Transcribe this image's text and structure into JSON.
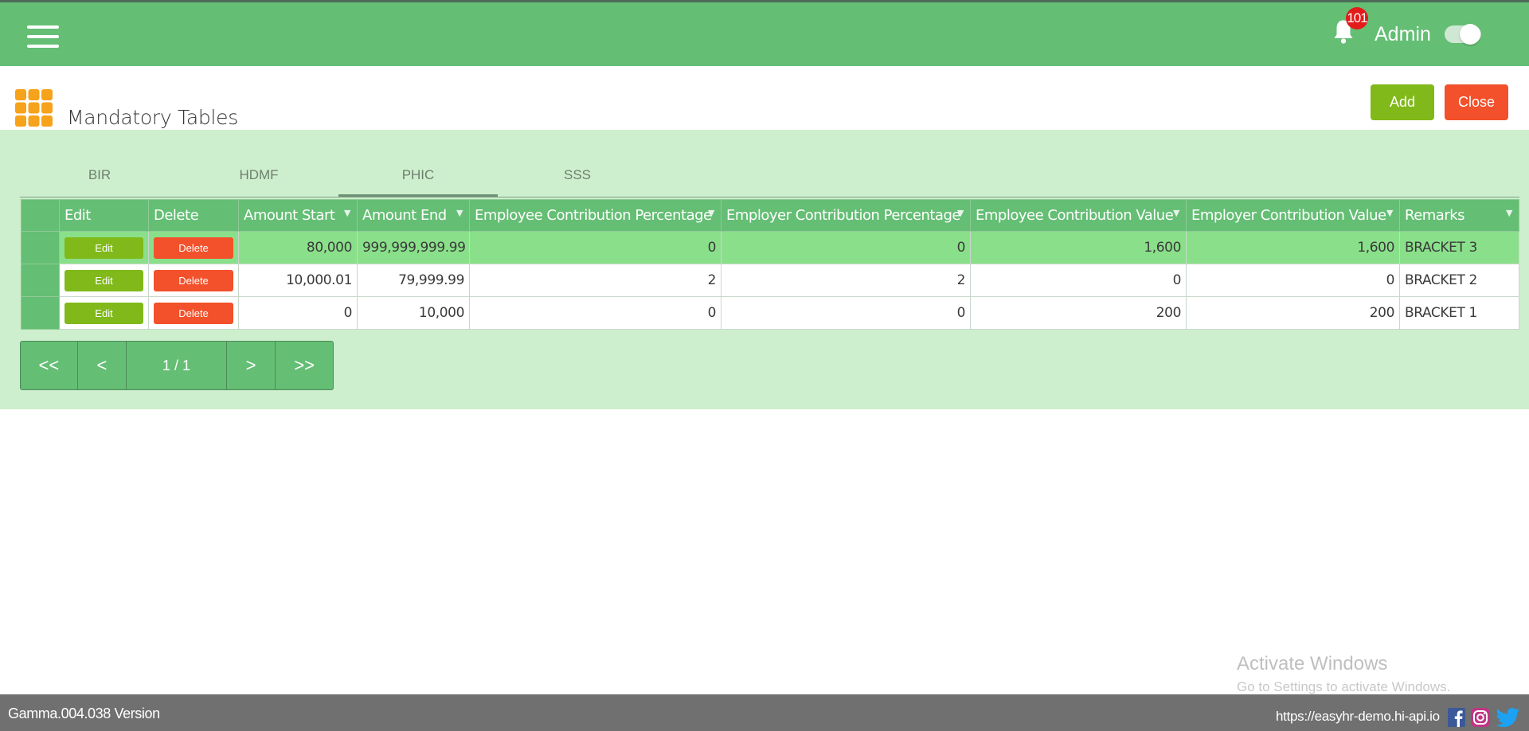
{
  "header": {
    "notification_count": "101",
    "user_name": "Admin"
  },
  "page": {
    "title": "Mandatory Tables",
    "add_label": "Add",
    "close_label": "Close"
  },
  "tabs": [
    {
      "label": "BIR"
    },
    {
      "label": "HDMF"
    },
    {
      "label": "PHIC"
    },
    {
      "label": "SSS"
    }
  ],
  "active_tab": "PHIC",
  "table": {
    "columns": [
      "Edit",
      "Delete",
      "Amount Start",
      "Amount End",
      "Employee Contribution Percentage",
      "Employer Contribution Percentage",
      "Employee Contribution Value",
      "Employer Contribution Value",
      "Remarks"
    ],
    "edit_label": "Edit",
    "delete_label": "Delete",
    "rows": [
      {
        "amount_start": "80,000",
        "amount_end": "999,999,999.99",
        "ee_pct": "0",
        "er_pct": "0",
        "ee_val": "1,600",
        "er_val": "1,600",
        "remarks": "BRACKET 3"
      },
      {
        "amount_start": "10,000.01",
        "amount_end": "79,999.99",
        "ee_pct": "2",
        "er_pct": "2",
        "ee_val": "0",
        "er_val": "0",
        "remarks": "BRACKET 2"
      },
      {
        "amount_start": "0",
        "amount_end": "10,000",
        "ee_pct": "0",
        "er_pct": "0",
        "ee_val": "200",
        "er_val": "200",
        "remarks": "BRACKET 1"
      }
    ]
  },
  "pager": {
    "first": "<<",
    "prev": "<",
    "info": "1 / 1",
    "next": ">",
    "last": ">>"
  },
  "watermark": {
    "line1": "Activate Windows",
    "line2": "Go to Settings to activate Windows."
  },
  "footer": {
    "version": "Gamma.004.038 Version",
    "url": "https://easyhr-demo.hi-api.io"
  },
  "colors": {
    "primary_green": "#64be74",
    "light_green_bg": "#cdefcd",
    "selected_row": "#8ae08a",
    "add_green": "#80b919",
    "danger_orange": "#f2512b",
    "footer_gray": "#707070",
    "logo_orange": "#f7a21b"
  },
  "icons": [
    "menu-icon",
    "bell-icon",
    "moon-icon",
    "grid-icon",
    "filter-icon",
    "facebook-icon",
    "instagram-icon",
    "twitter-icon"
  ]
}
